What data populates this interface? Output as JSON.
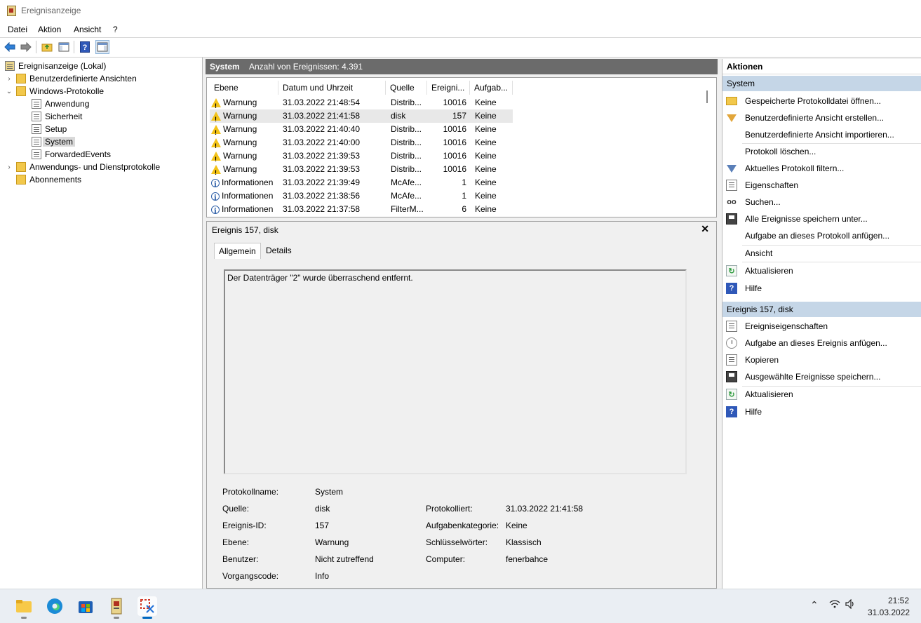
{
  "window": {
    "title": "Ereignisanzeige"
  },
  "menu": [
    "Datei",
    "Aktion",
    "Ansicht",
    "?"
  ],
  "toolbar": {
    "buttons": [
      "back-arrow-icon",
      "forward-arrow-icon",
      "up-folder-icon",
      "show-tree-icon",
      "help-icon",
      "action-pane-icon"
    ]
  },
  "tree": {
    "root": "Ereignisanzeige (Lokal)",
    "custom_views": "Benutzerdefinierte Ansichten",
    "windows_logs": "Windows-Protokolle",
    "logs": [
      "Anwendung",
      "Sicherheit",
      "Setup",
      "System",
      "ForwardedEvents"
    ],
    "app_service_logs": "Anwendungs- und Dienstprotokolle",
    "subscriptions": "Abonnements"
  },
  "center": {
    "log_name": "System",
    "event_count": "Anzahl von Ereignissen: 4.391",
    "columns": [
      "Ebene",
      "Datum und Uhrzeit",
      "Quelle",
      "Ereigni...",
      "Aufgab..."
    ],
    "rows": [
      {
        "level": "Warnung",
        "icon": "warning-icon",
        "date": "31.03.2022 21:48:54",
        "source": "Distrib...",
        "id": "10016",
        "task": "Keine"
      },
      {
        "level": "Warnung",
        "icon": "warning-icon",
        "date": "31.03.2022 21:41:58",
        "source": "disk",
        "id": "157",
        "task": "Keine"
      },
      {
        "level": "Warnung",
        "icon": "warning-icon",
        "date": "31.03.2022 21:40:40",
        "source": "Distrib...",
        "id": "10016",
        "task": "Keine"
      },
      {
        "level": "Warnung",
        "icon": "warning-icon",
        "date": "31.03.2022 21:40:00",
        "source": "Distrib...",
        "id": "10016",
        "task": "Keine"
      },
      {
        "level": "Warnung",
        "icon": "warning-icon",
        "date": "31.03.2022 21:39:53",
        "source": "Distrib...",
        "id": "10016",
        "task": "Keine"
      },
      {
        "level": "Warnung",
        "icon": "warning-icon",
        "date": "31.03.2022 21:39:53",
        "source": "Distrib...",
        "id": "10016",
        "task": "Keine"
      },
      {
        "level": "Informationen",
        "icon": "info-icon",
        "date": "31.03.2022 21:39:49",
        "source": "McAfe...",
        "id": "1",
        "task": "Keine"
      },
      {
        "level": "Informationen",
        "icon": "info-icon",
        "date": "31.03.2022 21:38:56",
        "source": "McAfe...",
        "id": "1",
        "task": "Keine"
      },
      {
        "level": "Informationen",
        "icon": "info-icon",
        "date": "31.03.2022 21:37:58",
        "source": "FilterM...",
        "id": "6",
        "task": "Keine"
      }
    ]
  },
  "detail": {
    "title": "Ereignis 157, disk",
    "close": "✕",
    "tabs": [
      "Allgemein",
      "Details"
    ],
    "message": "Der Datenträger \"2\" wurde überraschend entfernt.",
    "labels": {
      "log_name": "Protokollname:",
      "source": "Quelle:",
      "event_id": "Ereignis-ID:",
      "level": "Ebene:",
      "user": "Benutzer:",
      "opcode": "Vorgangscode:",
      "logged": "Protokolliert:",
      "task_category": "Aufgabenkategorie:",
      "keywords": "Schlüsselwörter:",
      "computer": "Computer:"
    },
    "values": {
      "log_name": "System",
      "source": "disk",
      "event_id": "157",
      "level": "Warnung",
      "user": "Nicht zutreffend",
      "opcode": "Info",
      "logged": "31.03.2022 21:41:58",
      "task_category": "Keine",
      "keywords": "Klassisch",
      "computer": "fenerbahce"
    }
  },
  "actions": {
    "header": "Aktionen",
    "section1": "System",
    "items1": [
      "Gespeicherte Protokolldatei öffnen...",
      "Benutzerdefinierte Ansicht erstellen...",
      "Benutzerdefinierte Ansicht importieren...",
      "Protokoll löschen...",
      "Aktuelles Protokoll filtern...",
      "Eigenschaften",
      "Suchen...",
      "Alle Ereignisse speichern unter...",
      "Aufgabe an dieses Protokoll anfügen...",
      "Ansicht",
      "Aktualisieren",
      "Hilfe"
    ],
    "section2": "Ereignis 157, disk",
    "items2": [
      "Ereigniseigenschaften",
      "Aufgabe an dieses Ereignis anfügen...",
      "Kopieren",
      "Ausgewählte Ereignisse speichern...",
      "Aktualisieren",
      "Hilfe"
    ]
  },
  "taskbar": {
    "apps": [
      "file-explorer-icon",
      "edge-icon",
      "store-icon",
      "event-viewer-icon",
      "snipping-tool-icon"
    ],
    "time": "21:52",
    "date": "31.03.2022"
  }
}
